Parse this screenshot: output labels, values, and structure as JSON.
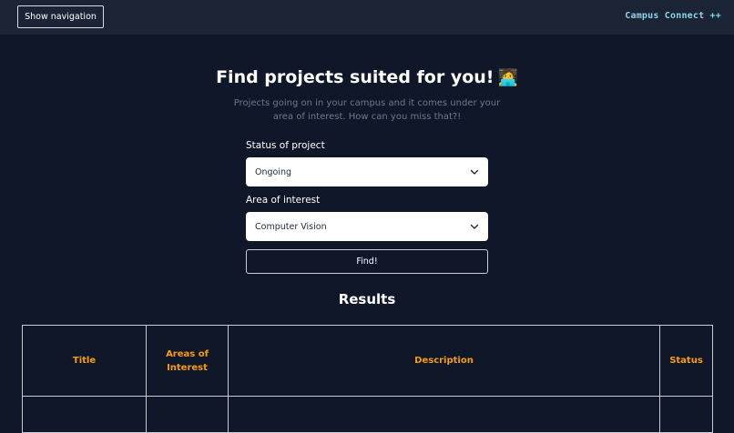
{
  "header": {
    "nav_button_label": "Show navigation",
    "brand": "Campus Connect ++"
  },
  "main": {
    "heading": "Find projects suited for you!",
    "heading_emoji": "🧑‍💻",
    "subtitle": "Projects going on in your campus and it comes under your area of interest. How can you miss that?!",
    "status_label": "Status of project",
    "status_value": "Ongoing",
    "area_label": "Area of interest",
    "area_value": "Computer Vision",
    "find_button": "Find!"
  },
  "results": {
    "title": "Results",
    "columns": [
      "Title",
      "Areas of Interest",
      "Description",
      "Status"
    ]
  },
  "colors": {
    "background": "#0f1729",
    "topbar": "#1c2535",
    "brand": "#8ad6e6",
    "column_header": "#f59e0b"
  },
  "icons": {
    "select_arrow": "chevron-down-icon"
  }
}
